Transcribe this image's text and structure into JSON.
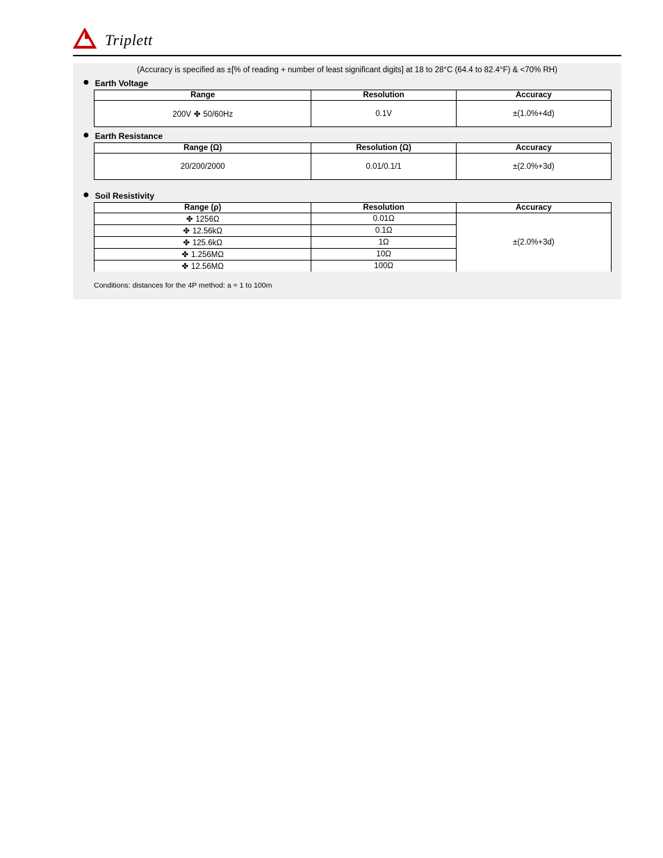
{
  "header": {
    "company": "Triplett"
  },
  "conditions_line": "(Accuracy is specified as ±[% of reading + number of least significant digits] at 18 to 28°C (64.4 to 82.4°F) & <70% RH)",
  "sections": {
    "earth_voltage": {
      "title": "Earth Voltage",
      "table": {
        "headers": [
          "Range",
          "Resolution",
          "Accuracy"
        ],
        "rows": [
          {
            "range": "200V ✤ 50/60Hz",
            "resolution": "0.1V"
          }
        ],
        "accuracy": "±(1.0%+4d)"
      }
    },
    "earth_resistance": {
      "title": "Earth Resistance",
      "table": {
        "headers": [
          "Range (Ω)",
          "Resolution (Ω)",
          "Accuracy"
        ],
        "rows": [
          {
            "range": "20/200/2000",
            "resolution": "0.01/0.1/1"
          }
        ],
        "accuracy": "±(2.0%+3d)"
      }
    },
    "soil_resistivity": {
      "title": "Soil Resistivity",
      "table": {
        "headers": [
          "Range (ρ)",
          "Resolution",
          "Accuracy"
        ],
        "rows": [
          {
            "range": "✤ 1256Ω",
            "resolution": "0.01Ω"
          },
          {
            "range": "✤ 12.56kΩ",
            "resolution": "0.1Ω"
          },
          {
            "range": "✤ 125.6kΩ",
            "resolution": "1Ω"
          },
          {
            "range": "✤ 1.256MΩ",
            "resolution": "10Ω"
          },
          {
            "range": "✤ 12.56MΩ",
            "resolution": "100Ω"
          }
        ],
        "accuracy": "±(2.0%+3d)"
      }
    },
    "conditions": "Conditions: distances for the 4P method: a = 1 to 100m"
  },
  "chart_data": {
    "type": "table",
    "title": "Specification tables (Earth Voltage / Earth Resistance / Soil Resistivity)",
    "tables": [
      {
        "name": "Earth Voltage",
        "columns": [
          "Range",
          "Resolution",
          "Accuracy"
        ],
        "rows": [
          [
            "200V 50/60Hz",
            "0.1V",
            "±(1.0%+4d)"
          ]
        ]
      },
      {
        "name": "Earth Resistance",
        "columns": [
          "Range (Ω)",
          "Resolution (Ω)",
          "Accuracy"
        ],
        "rows": [
          [
            "20/200/2000",
            "0.01/0.1/1",
            "±(2.0%+3d)"
          ]
        ]
      },
      {
        "name": "Soil Resistivity",
        "columns": [
          "Range (ρ)",
          "Resolution",
          "Accuracy"
        ],
        "rows": [
          [
            "1256Ω",
            "0.01Ω",
            "±(2.0%+3d)"
          ],
          [
            "12.56kΩ",
            "0.1Ω",
            "±(2.0%+3d)"
          ],
          [
            "125.6kΩ",
            "1Ω",
            "±(2.0%+3d)"
          ],
          [
            "1.256MΩ",
            "10Ω",
            "±(2.0%+3d)"
          ],
          [
            "12.56MΩ",
            "100Ω",
            "±(2.0%+3d)"
          ]
        ]
      }
    ]
  }
}
